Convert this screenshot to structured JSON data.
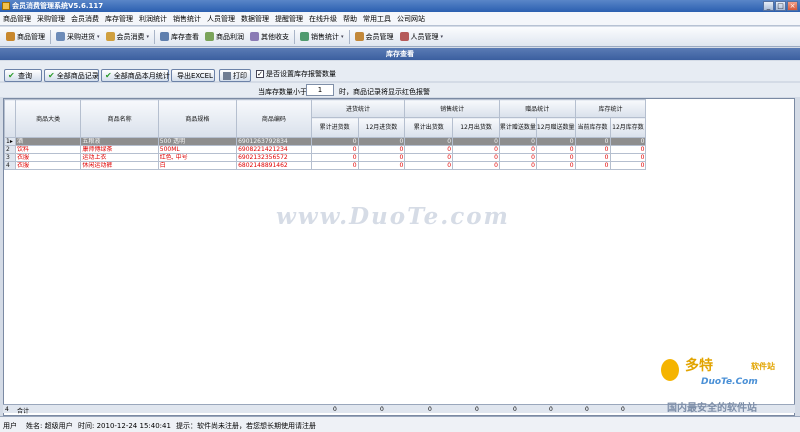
{
  "window": {
    "title": "会员消费管理系统V5.6.117"
  },
  "menu": [
    "商品管理",
    "采购管理",
    "会员消费",
    "库存管理",
    "利润统计",
    "销售统计",
    "人员管理",
    "数据管理",
    "提醒管理",
    "在线升级",
    "帮助",
    "常用工具",
    "公司网站"
  ],
  "toolbar": [
    {
      "label": "商品管理",
      "icon": "box-icon",
      "color": "#c8882e"
    },
    {
      "label": "采购进货",
      "icon": "cart-icon",
      "color": "#6c8bb8",
      "dropdown": "▾"
    },
    {
      "label": "会员消费",
      "icon": "member-icon",
      "color": "#d0a040",
      "dropdown": "▾"
    },
    {
      "label": "库存查看",
      "icon": "warehouse-icon",
      "color": "#5f7fae"
    },
    {
      "label": "商品利润",
      "icon": "profit-icon",
      "color": "#7aa35a"
    },
    {
      "label": "其他收支",
      "icon": "ledger-icon",
      "color": "#8a7bb5"
    },
    {
      "label": "销售统计",
      "icon": "chart-icon",
      "color": "#4f9a6f",
      "dropdown": "▾"
    },
    {
      "label": "会员管理",
      "icon": "users-icon",
      "color": "#c2883a"
    },
    {
      "label": "人员管理",
      "icon": "person-icon",
      "color": "#b55a5a",
      "dropdown": "▾"
    }
  ],
  "panel": {
    "title": "库存查看"
  },
  "actions": {
    "query": "查询",
    "all_records": "全部商品记录",
    "month_stats": "全部商品本月统计",
    "export": "导出EXCEL",
    "print": "打印",
    "checkbox_checked": "✓",
    "checkbox_label": "是否设置库存报警数量"
  },
  "threshold": {
    "label": "当库存数量小于",
    "value": "1",
    "note": "时，商品记录将显示红色报警"
  },
  "table": {
    "headers": {
      "category": "商品大类",
      "name": "商品名称",
      "spec": "商品规格",
      "code": "商品编码",
      "purchase_group": "进货统计",
      "sales_group": "销售统计",
      "gift_group": "赠品统计",
      "stock_group": "库存统计",
      "purchase_total": "累计进货数",
      "purchase_month": "12月进货数",
      "sales_total": "累计出货数",
      "sales_month": "12月出货数",
      "gift_total": "累计赠送数量",
      "gift_month": "12月赠送数量",
      "stock_current": "当前库存数",
      "stock_month": "12月库存数"
    },
    "rows": [
      {
        "idx": "1",
        "marker": "▸",
        "category": "酒",
        "name": "五粮液",
        "spec": "500 透明",
        "code": "6901263792834",
        "v": [
          "0",
          "0",
          "0",
          "0",
          "0",
          "0",
          "0",
          "0"
        ]
      },
      {
        "idx": "2",
        "marker": "",
        "category": "饮料",
        "name": "康师傅绿茶",
        "spec": "500ML",
        "code": "6908221421234",
        "v": [
          "0",
          "0",
          "0",
          "0",
          "0",
          "0",
          "0",
          "0"
        ]
      },
      {
        "idx": "3",
        "marker": "",
        "category": "衣服",
        "name": "运动上衣",
        "spec": "红色, 中号",
        "code": "6902132356572",
        "v": [
          "0",
          "0",
          "0",
          "0",
          "0",
          "0",
          "0",
          "0"
        ]
      },
      {
        "idx": "4",
        "marker": "",
        "category": "衣服",
        "name": "休闲运动裤",
        "spec": "白",
        "code": "6802148891462",
        "v": [
          "0",
          "0",
          "0",
          "0",
          "0",
          "0",
          "0",
          "0"
        ]
      }
    ],
    "footer": {
      "idx": "4",
      "label": "合计",
      "zeros": [
        "0",
        "0",
        "0",
        "0",
        "0",
        "0",
        "0",
        "0"
      ]
    }
  },
  "watermark": "www.DuoTe.com",
  "status": {
    "user": "用户",
    "name": "姓名: 超级用户",
    "time": "时间: 2010-12-24 15:40:41",
    "tip": "提示：软件尚未注册，若您想长期使用请注册"
  },
  "brand": {
    "line1": "多特",
    "line2": "软件站",
    "line3": "DuoTe.Com",
    "line4": "国内最安全的软件站"
  }
}
